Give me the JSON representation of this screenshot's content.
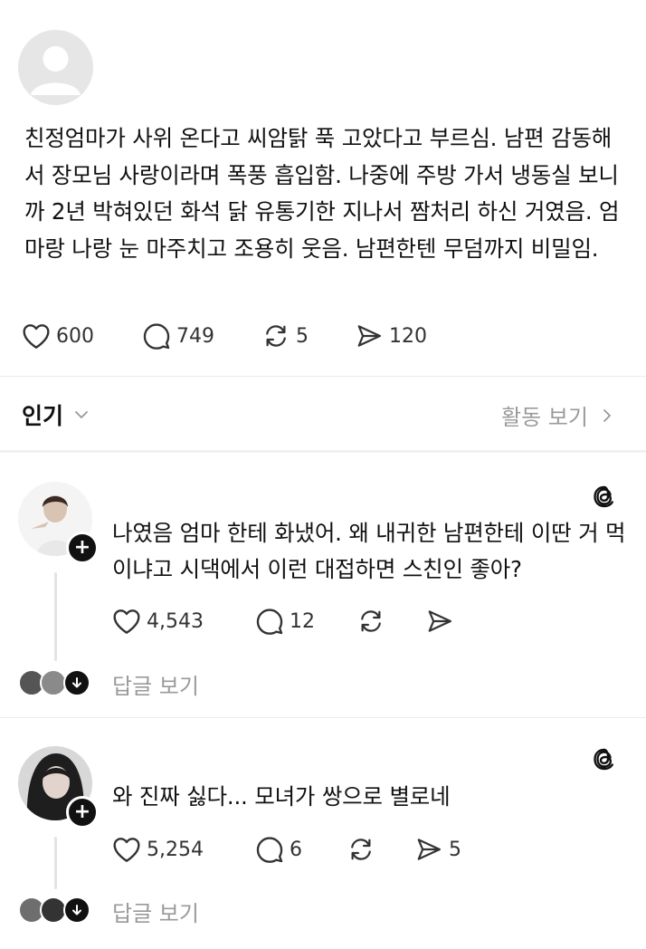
{
  "post": {
    "text": "친정엄마가 사위 온다고 씨암탉 푹 고았다고 부르심. 남편 감동해서 장모님 사랑이라며 폭풍 흡입함. 나중에 주방 가서 냉동실 보니까 2년 박혀있던 화석 닭 유통기한 지나서 짬처리 하신 거였음. 엄마랑 나랑 눈 마주치고 조용히 웃음. 남편한텐 무덤까지 비밀임.",
    "likes": "600",
    "comments": "749",
    "reposts": "5",
    "shares": "120"
  },
  "sort_bar": {
    "sort_label": "인기",
    "activity_label": "활동 보기"
  },
  "comments": [
    {
      "text": "나였음 엄마 한테 화냈어. 왜 내귀한 남편한테 이딴 거 먹이냐고 시댁에서 이런 대접하면 스친인 좋아?",
      "likes": "4,543",
      "replies": "12",
      "view_replies": "답글 보기"
    },
    {
      "text": "와 진짜 싫다... 모녀가 쌍으로 별로네",
      "likes": "5,254",
      "replies": "6",
      "shares": "5",
      "view_replies": "답글 보기"
    }
  ],
  "icons": {
    "like": "heart-icon",
    "comment": "comment-bubble-icon",
    "repost": "repost-icon",
    "share": "send-icon",
    "threads": "threads-logo-icon"
  }
}
